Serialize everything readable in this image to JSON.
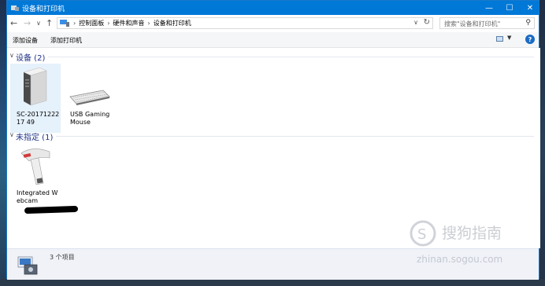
{
  "window": {
    "title": "设备和打印机"
  },
  "address": {
    "crumbs": [
      "控制面板",
      "硬件和声音",
      "设备和打印机"
    ]
  },
  "search": {
    "placeholder": "搜索\"设备和打印机\""
  },
  "toolbar": {
    "add_device": "添加设备",
    "add_printer": "添加打印机"
  },
  "groups": {
    "devices": {
      "title": "设备 (2)",
      "items": [
        {
          "label": "SC-2017122217 49",
          "icon": "computer-tower-icon"
        },
        {
          "label": "USB Gaming Mouse",
          "icon": "keyboard-icon"
        }
      ]
    },
    "unspecified": {
      "title": "未指定 (1)",
      "items": [
        {
          "label": "Integrated Webcam",
          "icon": "barcode-scanner-icon"
        }
      ]
    }
  },
  "details": {
    "count": "3 个项目"
  },
  "watermark": {
    "brand": "搜狗指南",
    "site": "zhinan.sogou.com"
  },
  "colors": {
    "titlebar": "#0078d7",
    "group_title": "#1e3287",
    "selection": "#e5f1fb"
  }
}
